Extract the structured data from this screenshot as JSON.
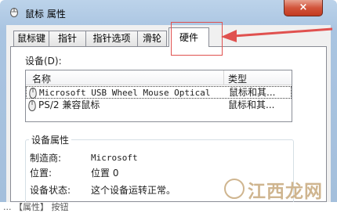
{
  "window": {
    "title": "鼠标 属性",
    "close_label": "×"
  },
  "tabs": [
    {
      "label": "鼠标键",
      "active": false
    },
    {
      "label": "指针",
      "active": false
    },
    {
      "label": "指针选项",
      "active": false
    },
    {
      "label": "滑轮",
      "active": false
    },
    {
      "label": "硬件",
      "active": true
    }
  ],
  "devices": {
    "label": "设备(D):",
    "columns": [
      "名称",
      "类型"
    ],
    "rows": [
      {
        "name": "Microsoft USB Wheel Mouse Optical",
        "type": "鼠标和其...",
        "icon": "mouse-icon",
        "selected": true
      },
      {
        "name": "PS/2 兼容鼠标",
        "type": "鼠标和其...",
        "icon": "mouse-icon",
        "selected": false
      }
    ]
  },
  "properties": {
    "title": "设备属性",
    "items": [
      {
        "key": "制造商:",
        "value": "Microsoft"
      },
      {
        "key": "位置:",
        "value": "位置 0"
      },
      {
        "key": "设备状态:",
        "value": "这个设备运转正常。"
      }
    ]
  },
  "watermark": {
    "text": "江西龙网"
  },
  "caption": {
    "text": "... 【属性】 按钮"
  },
  "colors": {
    "annotation": "#e0514f",
    "title_bar": "#bcd3ea",
    "close_button": "#c9452c"
  }
}
